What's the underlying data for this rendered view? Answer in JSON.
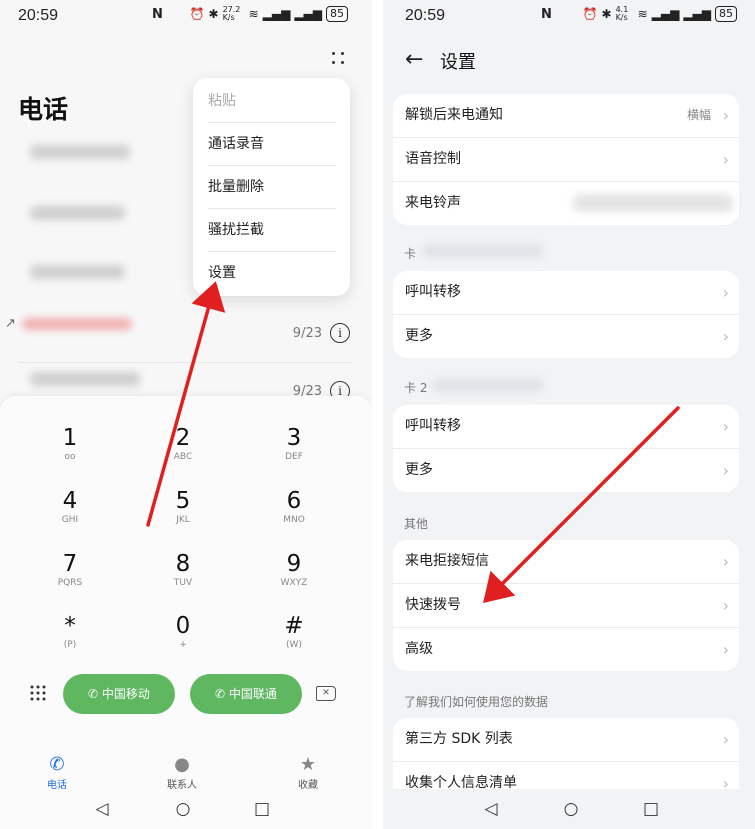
{
  "status": {
    "time": "20:59",
    "nfc": "N",
    "speed_left": "27.2 K/s",
    "speed_right": "4.1 K/s",
    "battery": "85"
  },
  "left": {
    "title": "电话",
    "calls": [
      {
        "date": "9/23"
      },
      {
        "date": "9/23"
      }
    ],
    "menu": [
      "粘贴",
      "通话录音",
      "批量删除",
      "骚扰拦截",
      "设置"
    ],
    "dialpad": [
      {
        "d": "1",
        "l": "ᴏᴏ"
      },
      {
        "d": "2",
        "l": "ABC"
      },
      {
        "d": "3",
        "l": "DEF"
      },
      {
        "d": "4",
        "l": "GHI"
      },
      {
        "d": "5",
        "l": "JKL"
      },
      {
        "d": "6",
        "l": "MNO"
      },
      {
        "d": "7",
        "l": "PQRS"
      },
      {
        "d": "8",
        "l": "TUV"
      },
      {
        "d": "9",
        "l": "WXYZ"
      },
      {
        "d": "*",
        "l": "(P)"
      },
      {
        "d": "0",
        "l": "+"
      },
      {
        "d": "#",
        "l": "(W)"
      }
    ],
    "sim1": "中国移动",
    "sim2": "中国联通",
    "tabs": [
      "电话",
      "联系人",
      "收藏"
    ]
  },
  "right": {
    "title": "设置",
    "group1": [
      {
        "label": "解锁后来电通知",
        "value": "横幅"
      },
      {
        "label": "语音控制"
      },
      {
        "label": "来电铃声"
      }
    ],
    "card1_label": "卡",
    "group2": [
      "呼叫转移",
      "更多"
    ],
    "card2_label": "卡 2",
    "group3": [
      "呼叫转移",
      "更多"
    ],
    "other_label": "其他",
    "group4": [
      "来电拒接短信",
      "快速拨号",
      "高级"
    ],
    "data_label": "了解我们如何使用您的数据",
    "group5": [
      "第三方 SDK 列表",
      "收集个人信息清单"
    ]
  },
  "colors": {
    "call_green": "#5fb860",
    "active_tab": "#1a6fe0",
    "annotation_red": "#e02020"
  }
}
